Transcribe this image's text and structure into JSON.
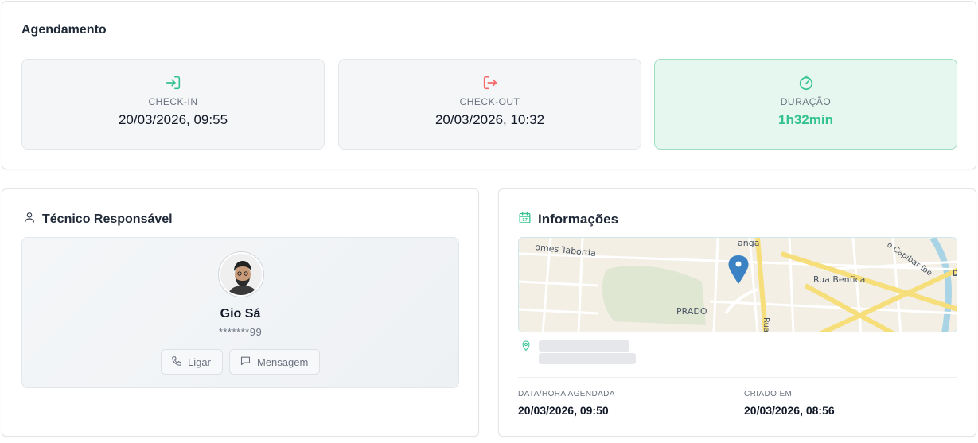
{
  "agendamento": {
    "title": "Agendamento",
    "checkin": {
      "label": "CHECK-IN",
      "value": "20/03/2026, 09:55",
      "icon": "login-icon",
      "color": "#34c38f"
    },
    "checkout": {
      "label": "CHECK-OUT",
      "value": "20/03/2026, 10:32",
      "icon": "logout-icon",
      "color": "#f46a6a"
    },
    "duracao": {
      "label": "DURAÇÃO",
      "value": "1h32min",
      "icon": "timer-icon",
      "color": "#34c38f"
    }
  },
  "tecnico": {
    "title": "Técnico Responsável",
    "name": "Gio Sá",
    "phone": "*******99",
    "call_label": "Ligar",
    "message_label": "Mensagem"
  },
  "info": {
    "title": "Informações",
    "map": {
      "labels": [
        "omes Taborda",
        "Rua Benfica",
        "PRADO",
        "anga",
        "Rua",
        "o Capibar ibe",
        "D"
      ],
      "pin_color": "#3b82c4"
    },
    "scheduled_label": "DATA/HORA AGENDADA",
    "scheduled_value": "20/03/2026, 09:50",
    "created_label": "CRIADO EM",
    "created_value": "20/03/2026, 08:56"
  }
}
